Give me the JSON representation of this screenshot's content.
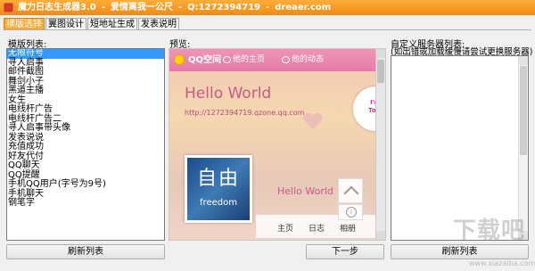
{
  "window": {
    "title": "魔力日志生成器3.0",
    "subtitle": "爱情离我一公尺",
    "qq": "Q:1272394719",
    "site": "dreaer.com"
  },
  "tabs": [
    {
      "label": "横版选择",
      "active": true
    },
    {
      "label": "翼图设计",
      "active": false
    },
    {
      "label": "短地址生成",
      "active": false
    },
    {
      "label": "发表说明",
      "active": false
    }
  ],
  "template_list": {
    "label": "模版列表:",
    "selected_index": 0,
    "items": [
      "无限符号",
      "寻人启事",
      "邮件截图",
      "舞剑小子",
      "黑道主播",
      "女生",
      "电线杆广告",
      "电线杆广告二",
      "寻人启事带头像",
      "发表说说",
      "充值成功",
      "好友代付",
      "QQ聊天",
      "QQ提醒",
      "手机QQ用户(字号为9号)",
      "手机聊天",
      "钢笔字"
    ],
    "refresh_button": "刷新列表"
  },
  "preview": {
    "label": "预览:",
    "qzone": {
      "title": "QQ空间",
      "nav_home": "他的主页",
      "nav_feed": "他的动态",
      "headline": "Hello World",
      "url": "http://1272394719.qzone.qq.com",
      "badge_line1": "I'm",
      "badge_line2": "Tom",
      "avatar_big": "自由",
      "avatar_small": "freedom",
      "name": "Hello World",
      "nav_items": [
        "主页",
        "日志",
        "相册"
      ]
    },
    "next_button": "下一步"
  },
  "server_list": {
    "label": "自定义服务器列表:",
    "hint": "(如出错或加载缓慢请尝试更换服务器)",
    "items": [],
    "refresh_button": "刷新列表"
  },
  "watermark": {
    "text": "下载吧",
    "url": "www.xiazaiba.com"
  },
  "colors": {
    "titlebar": "#f08a12",
    "active_tab": "#f7a93a",
    "selection": "#3399ff",
    "qzone_bar": "#e27ca7"
  }
}
